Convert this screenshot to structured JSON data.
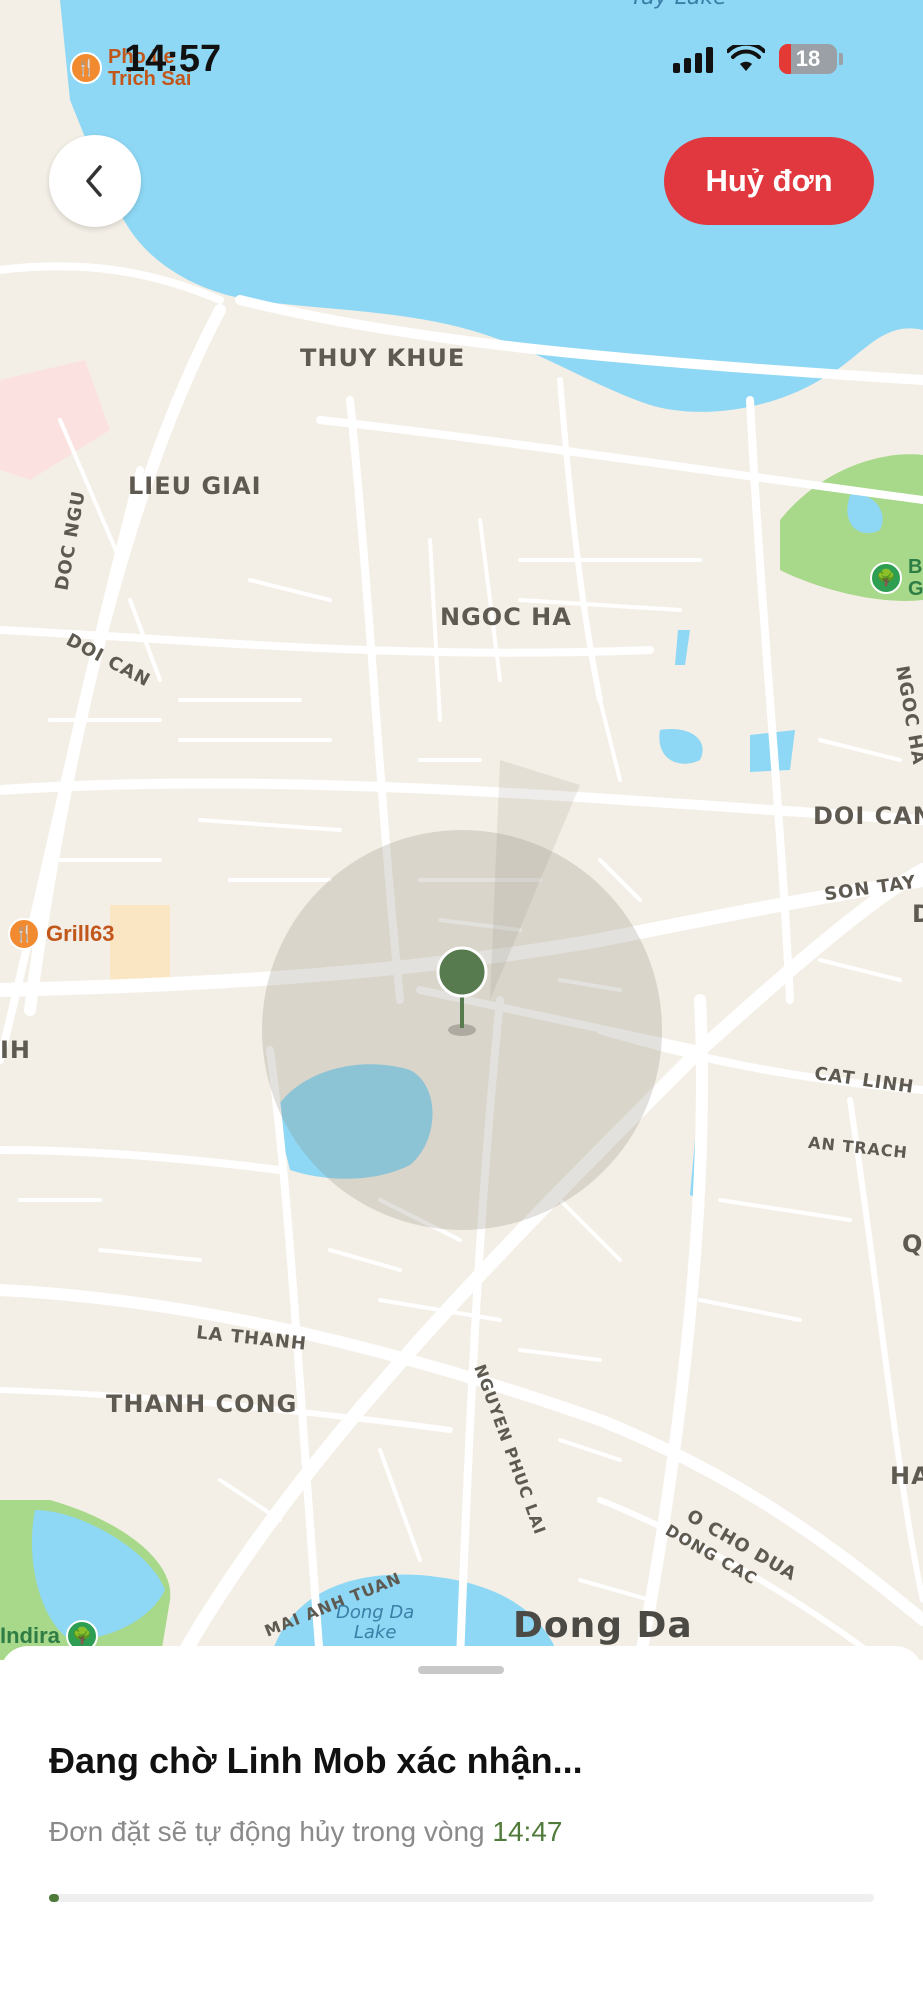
{
  "status_bar": {
    "time": "14:57",
    "battery": "18",
    "battery_level": 0.18
  },
  "header": {
    "cancel_label": "Huỷ đơn"
  },
  "map": {
    "districts": [
      "THUY KHUE",
      "LIEU GIAI",
      "NGOC HA",
      "DOI CAN",
      "THANH CONG",
      "Dong Da"
    ],
    "streets": [
      "DOC NGU",
      "DOI CAN",
      "NGOC HA",
      "SON TAY",
      "CAT LINH",
      "AN TRACH",
      "LA THANH",
      "NGUYEN PHUC LAI",
      "MAI ANH TUAN",
      "O CHO DUA",
      "DONG CAC"
    ],
    "edge_labels": [
      "D",
      "Q",
      "HA",
      "IH",
      "B",
      "G",
      "Tay Lake"
    ],
    "lakes": [
      "Dong Da",
      "Lake"
    ],
    "pois": [
      {
        "name": "Pho Le",
        "line2": "Trich Sai",
        "icon": "restaurant-icon"
      },
      {
        "name": "Grill63",
        "icon": "restaurant-icon"
      },
      {
        "name": "Indira",
        "icon": "park-icon"
      }
    ],
    "colors": {
      "water": "#8ed8f5",
      "land": "#f4efe6",
      "road": "#ffffff",
      "park": "#a8d88a",
      "pin": "#577a4f"
    }
  },
  "sheet": {
    "title": "Đang chờ Linh Mob xác nhận...",
    "subtitle_prefix": "Đơn đặt sẽ tự động hủy trong vòng ",
    "countdown": "14:47",
    "progress": 0.006
  },
  "colors": {
    "accent_red": "#e0383e",
    "accent_green": "#4f7a3a"
  }
}
